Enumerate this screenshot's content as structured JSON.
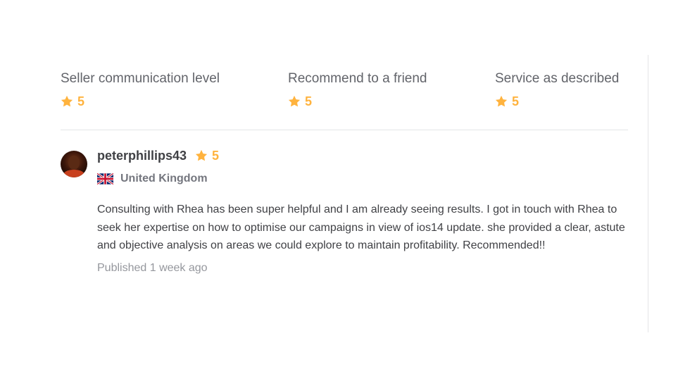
{
  "ratings": [
    {
      "label": "Seller communication level",
      "value": "5"
    },
    {
      "label": "Recommend to a friend",
      "value": "5"
    },
    {
      "label": "Service as described",
      "value": "5"
    }
  ],
  "review": {
    "username": "peterphillips43",
    "rating": "5",
    "country": "United Kingdom",
    "flag_icon": "uk-flag-icon",
    "text": "Consulting with Rhea has been super helpful and I am already seeing results. I got in touch with Rhea to seek her expertise on how to optimise our campaigns in view of ios14 update. she provided a clear, astute and objective analysis on areas we could explore to maintain profitability. Recommended!!",
    "published": "Published 1 week ago"
  },
  "colors": {
    "star": "#ffb33e",
    "text": "#404145",
    "muted": "#74767e",
    "divider": "#e4e5e7"
  },
  "icons": {
    "star": "star-icon",
    "avatar": "avatar"
  }
}
